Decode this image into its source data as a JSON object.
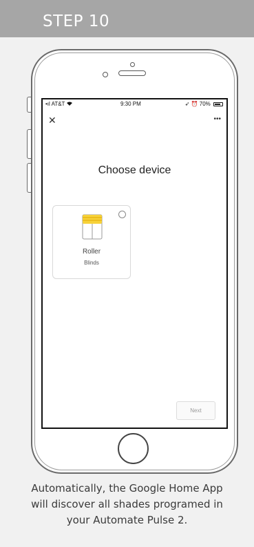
{
  "header": {
    "title": "STEP 10"
  },
  "status_bar": {
    "carrier": "AT&T",
    "time": "9:30 PM",
    "battery": "70%"
  },
  "screen": {
    "title": "Choose device",
    "device": {
      "name_line1": "Roller",
      "name_line2": "Blinds",
      "selected": false
    },
    "next_label": "Next"
  },
  "caption": {
    "lines": [
      "Automatically, the Google Home App",
      "will discover all shades programed in",
      "your Automate Pulse 2."
    ]
  },
  "icons": {
    "close": "close-icon",
    "more": "more-icon",
    "blind": "roller-blind-icon",
    "signal": "signal-icon",
    "wifi": "wifi-icon",
    "battery": "battery-icon"
  },
  "colors": {
    "header_bg": "#a6a6a6",
    "page_bg": "#f1f1f1",
    "blind_yellow": "#f7d23a"
  }
}
